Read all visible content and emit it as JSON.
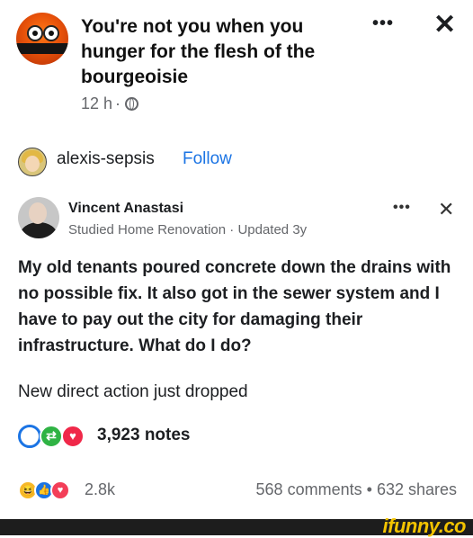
{
  "post": {
    "group_title": "You're not you when you hunger for the flesh of the bourgeoisie",
    "time": "12 h",
    "separator": "·",
    "globe_icon": "globe-icon",
    "more_icon": "more-icon",
    "close_icon": "close-icon"
  },
  "author": {
    "name": "alexis-sepsis",
    "follow_label": "Follow"
  },
  "shared_post": {
    "name": "Vincent Anastasi",
    "subtitle": "Studied Home Renovation · Updated 3y",
    "question": "My old tenants poured concrete down the drains with no possible fix. It also got in the sewer system and I have to pay out the city for damaging their infrastructure. What do I do?"
  },
  "caption": "New direct action just dropped",
  "notes": {
    "count_text": "3,923 notes",
    "icons": [
      "comment-icon",
      "reblog-icon",
      "heart-icon"
    ]
  },
  "reactions": {
    "count": "2.8k",
    "icons": [
      "haha-icon",
      "like-icon",
      "love-icon"
    ],
    "comments": "568 comments",
    "separator": "•",
    "shares": "632 shares"
  },
  "watermark": "ifunny.co",
  "colors": {
    "link_blue": "#1b74e4",
    "secondary_text": "#65676b",
    "reblog_green": "#2fb344",
    "heart_red": "#f02849",
    "watermark_yellow": "#f3c300"
  }
}
